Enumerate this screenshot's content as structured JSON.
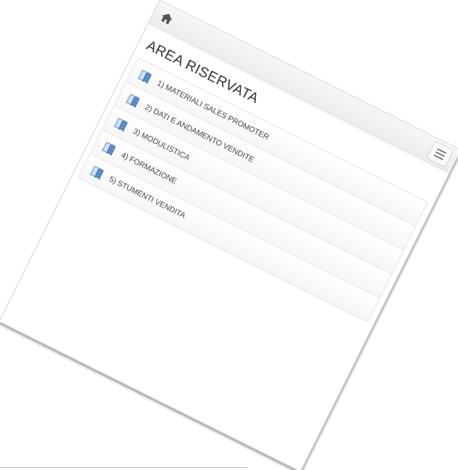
{
  "header": {
    "home_icon": "home-icon",
    "menu_icon": "hamburger-menu-icon"
  },
  "page": {
    "title": "AREA RISERVATA"
  },
  "menu": {
    "items": [
      {
        "label": "1) MATERIALI SALES PROMOTER",
        "icon": "book-icon"
      },
      {
        "label": "2) DATI E ANDAMENTO VENDITE",
        "icon": "book-icon"
      },
      {
        "label": "3) MODULISTICA",
        "icon": "book-icon"
      },
      {
        "label": "4) FORMAZIONE",
        "icon": "book-icon"
      },
      {
        "label": "5) STUMENTI VENDITA",
        "icon": "book-icon"
      }
    ]
  },
  "colors": {
    "icon_blue": "#5b8fc9",
    "text": "#333333"
  }
}
